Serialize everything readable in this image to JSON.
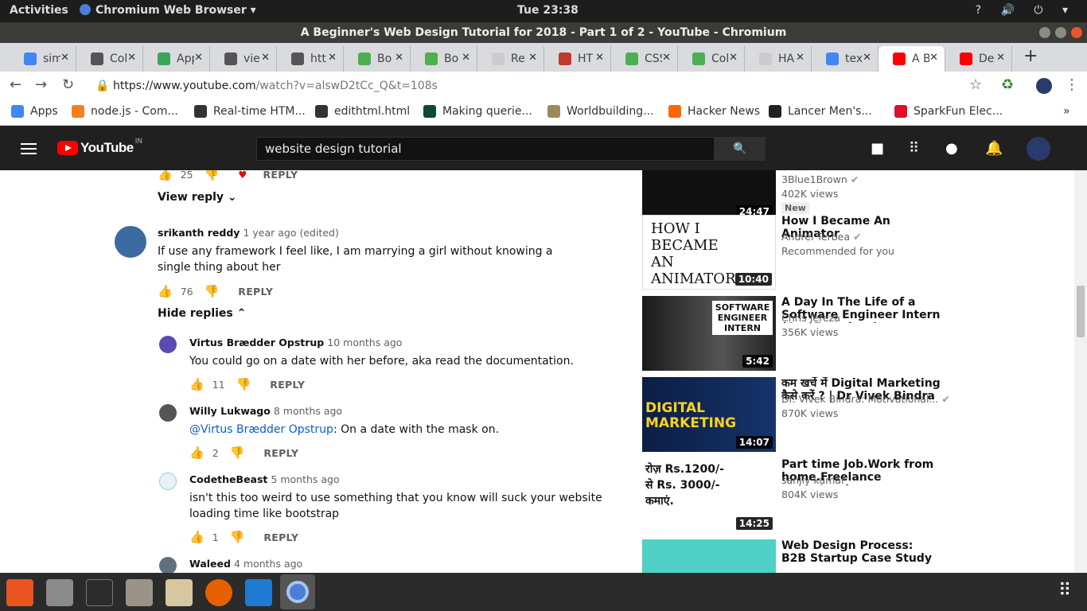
{
  "system": {
    "activities": "Activities",
    "app_name": "Chromium Web Browser",
    "clock": "Tue 23:38"
  },
  "window": {
    "title": "A Beginner's Web Design Tutorial for 2018 - Part 1 of 2 - YouTube - Chromium"
  },
  "tabs": [
    {
      "label": "sim",
      "icon": "google-icon",
      "color": "#4285f4"
    },
    {
      "label": "Col",
      "icon": "wordpress-icon",
      "color": "#555555"
    },
    {
      "label": "App",
      "icon": "app-icon",
      "color": "#3aa55a"
    },
    {
      "label": "vie",
      "icon": "wordpress-icon",
      "color": "#555555"
    },
    {
      "label": "htt",
      "icon": "wordpress-icon",
      "color": "#555555"
    },
    {
      "label": "Bo",
      "icon": "w3-icon",
      "color": "#4caf50"
    },
    {
      "label": "Bo",
      "icon": "w3-icon",
      "color": "#4caf50"
    },
    {
      "label": "Re",
      "icon": "loading-icon",
      "color": "#cccccc"
    },
    {
      "label": "HT",
      "icon": "hsu-icon",
      "color": "#c0392b"
    },
    {
      "label": "CSS",
      "icon": "w3-icon",
      "color": "#4caf50"
    },
    {
      "label": "Col",
      "icon": "w3-icon",
      "color": "#4caf50"
    },
    {
      "label": "HA",
      "icon": "loading-icon",
      "color": "#cccccc"
    },
    {
      "label": "tex",
      "icon": "google-icon",
      "color": "#4285f4"
    },
    {
      "label": "A B",
      "icon": "youtube-icon",
      "color": "#ff0000"
    },
    {
      "label": "De",
      "icon": "youtube-icon",
      "color": "#ff0000"
    }
  ],
  "omnibox": {
    "host": "https://www.youtube.com",
    "path": "/watch?v=alswD2tCc_Q&t=108s"
  },
  "bookmarks": [
    {
      "label": "Apps",
      "color": "#4285f4"
    },
    {
      "label": "node.js - Com...",
      "color": "#f48024"
    },
    {
      "label": "Real-time HTM...",
      "color": "#333333"
    },
    {
      "label": "edithtml.html",
      "color": "#333333"
    },
    {
      "label": "Making querie...",
      "color": "#0c4b33"
    },
    {
      "label": "Worldbuilding...",
      "color": "#9a8a5a"
    },
    {
      "label": "Hacker News",
      "color": "#ff6600"
    },
    {
      "label": "Lancer Men's...",
      "color": "#222222"
    },
    {
      "label": "SparkFun Elec...",
      "color": "#e0102a"
    }
  ],
  "youtube": {
    "logo": "YouTube",
    "country": "IN",
    "search_value": "website design tutorial"
  },
  "comments": {
    "top_likes": "25",
    "reply_label": "REPLY",
    "view_reply": "View reply",
    "hide_replies": "Hide replies",
    "main": {
      "author": "srikanth reddy",
      "when": "1 year ago (edited)",
      "text": "If use any framework I feel like, I am  marrying a girl without knowing a single thing about her",
      "likes": "76"
    },
    "replies": [
      {
        "author": "Virtus Brædder Opstrup",
        "when": "10 months ago",
        "text": "You could go on a date with her before, aka read the documentation.",
        "likes": "11",
        "mention": ""
      },
      {
        "author": "Willy Lukwago",
        "when": "8 months ago",
        "mention": "@Virtus Brædder Opstrup",
        "text": ": On a date with the mask on.",
        "likes": "2"
      },
      {
        "author": "CodetheBeast",
        "when": "5 months ago",
        "text": "isn't this too weird to use something that you know will suck your website loading time like bootstrap",
        "likes": "1",
        "mention": ""
      },
      {
        "author": "Waleed",
        "when": "4 months ago",
        "text": "",
        "likes": "",
        "mention": ""
      }
    ]
  },
  "sidebar": [
    {
      "title": "",
      "channel": "3Blue1Brown",
      "views": "402K views",
      "badge": "New",
      "duration": "24:47",
      "verified": true
    },
    {
      "title": "How I Became An Animator",
      "channel": "Andrei Terbea",
      "views": "Recommended for you",
      "duration": "10:40",
      "verified": true,
      "thumb_text": "HOW I BECAME AN ANIMATOR"
    },
    {
      "title": "A Day In The Life of a Software Engineer Intern (San Francisco)",
      "channel": "Chris Jereza",
      "views": "356K views",
      "duration": "5:42",
      "verified": false,
      "thumb_text": "SOFTWARE ENGINEER INTERN"
    },
    {
      "title": "कम खर्चे में Digital Marketing कैसे करें ? | Dr Vivek Bindra",
      "channel": "Dr. Vivek Bindra: Motivational...",
      "views": "870K views",
      "duration": "14:07",
      "verified": true,
      "thumb_text": "DIGITAL MARKETING"
    },
    {
      "title": "Part time Job.Work from home.Freelance work.Good...",
      "channel": "sanjiv kumar",
      "views": "804K views",
      "duration": "14:25",
      "verified": false,
      "thumb_text": "रोज़ Rs.1200/- से Rs. 3000/- कमाएं."
    },
    {
      "title": "Web Design Process: B2B Startup Case Study",
      "channel": "",
      "views": "",
      "duration": "",
      "verified": false
    }
  ]
}
